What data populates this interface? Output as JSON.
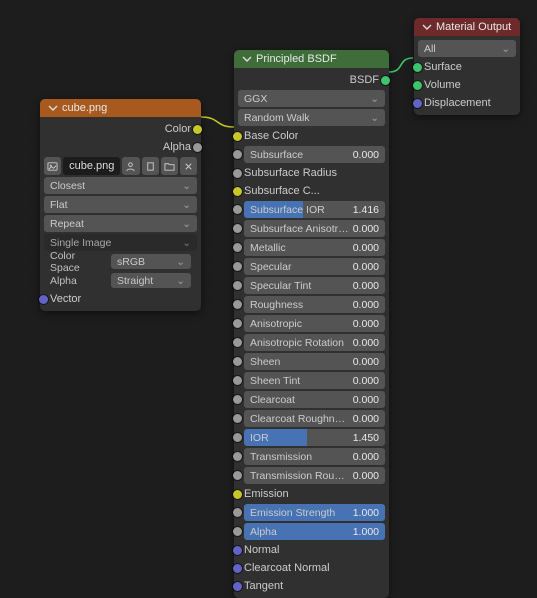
{
  "image_node": {
    "title": "cube.png",
    "outputs": {
      "color": "Color",
      "alpha": "Alpha"
    },
    "inputs": {
      "vector": "Vector"
    },
    "filename": "cube.png",
    "interpolation": "Closest",
    "projection": "Flat",
    "extension": "Repeat",
    "source": "Single Image",
    "color_space_label": "Color Space",
    "color_space": "sRGB",
    "alpha_label": "Alpha",
    "alpha_mode": "Straight"
  },
  "principled_node": {
    "title": "Principled BSDF",
    "outputs": {
      "bsdf": "BSDF"
    },
    "distribution": "GGX",
    "subsurface_method": "Random Walk",
    "rows": [
      {
        "name": "Base Color",
        "kind": "color_input",
        "swatch": "gray"
      },
      {
        "name": "Subsurface",
        "kind": "slider",
        "value": "0.000",
        "fill": 0
      },
      {
        "name": "Subsurface Radius",
        "kind": "label"
      },
      {
        "name": "Subsurface C...",
        "kind": "color",
        "swatch": "white"
      },
      {
        "name": "Subsurface IOR",
        "kind": "slider",
        "value": "1.416",
        "fill": 42
      },
      {
        "name": "Subsurface Anisotropy",
        "kind": "slider",
        "value": "0.000",
        "fill": 0
      },
      {
        "name": "Metallic",
        "kind": "slider",
        "value": "0.000",
        "fill": 0
      },
      {
        "name": "Specular",
        "kind": "slider",
        "value": "0.000",
        "fill": 0
      },
      {
        "name": "Specular Tint",
        "kind": "slider",
        "value": "0.000",
        "fill": 0
      },
      {
        "name": "Roughness",
        "kind": "slider",
        "value": "0.000",
        "fill": 0
      },
      {
        "name": "Anisotropic",
        "kind": "slider",
        "value": "0.000",
        "fill": 0
      },
      {
        "name": "Anisotropic Rotation",
        "kind": "slider",
        "value": "0.000",
        "fill": 0
      },
      {
        "name": "Sheen",
        "kind": "slider",
        "value": "0.000",
        "fill": 0
      },
      {
        "name": "Sheen Tint",
        "kind": "slider",
        "value": "0.000",
        "fill": 0
      },
      {
        "name": "Clearcoat",
        "kind": "slider",
        "value": "0.000",
        "fill": 0
      },
      {
        "name": "Clearcoat Roughness",
        "kind": "slider",
        "value": "0.000",
        "fill": 0
      },
      {
        "name": "IOR",
        "kind": "slider",
        "value": "1.450",
        "fill": 45
      },
      {
        "name": "Transmission",
        "kind": "slider",
        "value": "0.000",
        "fill": 0
      },
      {
        "name": "Transmission Roughness",
        "kind": "slider",
        "value": "0.000",
        "fill": 0
      },
      {
        "name": "Emission",
        "kind": "color",
        "swatch": "black"
      },
      {
        "name": "Emission Strength",
        "kind": "slider",
        "value": "1.000",
        "fill": 100
      },
      {
        "name": "Alpha",
        "kind": "slider",
        "value": "1.000",
        "fill": 100
      },
      {
        "name": "Normal",
        "kind": "label",
        "sock": "purple"
      },
      {
        "name": "Clearcoat Normal",
        "kind": "label",
        "sock": "purple"
      },
      {
        "name": "Tangent",
        "kind": "label",
        "sock": "purple"
      }
    ]
  },
  "output_node": {
    "title": "Material Output",
    "target": "All",
    "inputs": {
      "surface": "Surface",
      "volume": "Volume",
      "displacement": "Displacement"
    }
  },
  "colors": {
    "link_yellow": "#c7c729",
    "link_green": "#3dc46c"
  }
}
